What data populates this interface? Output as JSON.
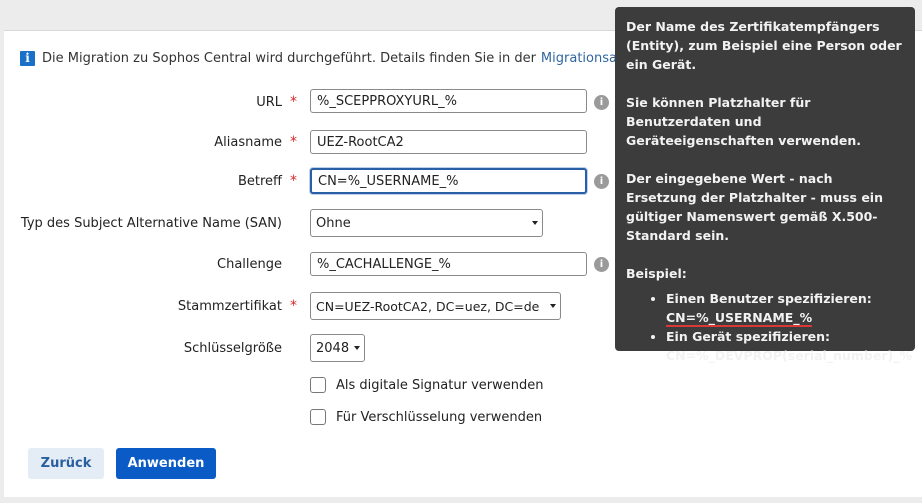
{
  "banner": {
    "text": "Die Migration zu Sophos Central wird durchgeführt. Details finden Sie in der",
    "link": "Migrationsan"
  },
  "form": {
    "url": {
      "label": "URL",
      "value": "%_SCEPPROXYURL_%"
    },
    "alias": {
      "label": "Aliasname",
      "value": "UEZ-RootCA2"
    },
    "subject": {
      "label": "Betreff",
      "value": "CN=%_USERNAME_%"
    },
    "san": {
      "label": "Typ des Subject Alternative Name (SAN)",
      "value": "Ohne"
    },
    "challenge": {
      "label": "Challenge",
      "value": "%_CACHALLENGE_%"
    },
    "root_cert": {
      "label": "Stammzertifikat",
      "value": "CN=UEZ-RootCA2, DC=uez, DC=de"
    },
    "key_size": {
      "label": "Schlüsselgröße",
      "value": "2048"
    },
    "digital_signature": {
      "label": "Als digitale Signatur verwenden",
      "checked": false
    },
    "encryption": {
      "label": "Für Verschlüsselung verwenden",
      "checked": false
    },
    "required_mark": "*",
    "help_glyph": "i"
  },
  "buttons": {
    "back": "Zurück",
    "apply": "Anwenden"
  },
  "tooltip": {
    "p1": "Der Name des Zertifikatempfängers (Entity), zum Beispiel eine Person oder ein Gerät.",
    "p2": "Sie können Platzhalter für Benutzerdaten und Geräteeigenschaften verwenden.",
    "p3": "Der eingegebene Wert - nach Ersetzung der Platzhalter - muss ein gültiger Namenswert gemäß X.500-Standard sein.",
    "example_heading": "Beispiel:",
    "ex1_text": "Einen Benutzer spezifizieren:",
    "ex1_value": "CN=%_USERNAME_%",
    "ex2_text": "Ein Gerät spezifizieren:",
    "ex2_value": "CN=%_DEVPROP(serial_number)_%"
  },
  "colors": {
    "primary": "#0a5bc6",
    "required": "#d9262a",
    "tooltip_bg": "#3c3c3c",
    "info_icon": "#1a6fc9"
  }
}
